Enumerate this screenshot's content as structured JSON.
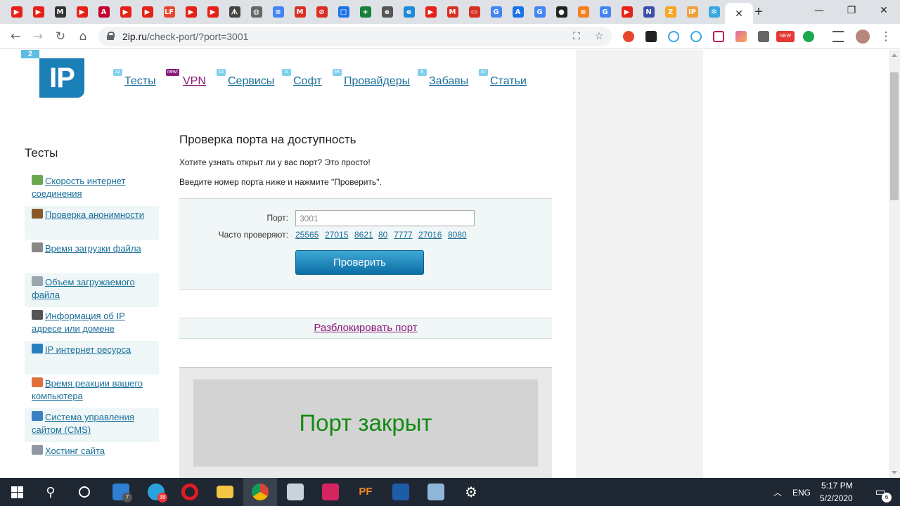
{
  "browser": {
    "url_host": "2ip.ru",
    "url_path": "/check-port/?port=3001",
    "tabs": [
      {
        "icon": "youtube-icon",
        "color": "#e62117",
        "glyph": "▶"
      },
      {
        "icon": "youtube-icon",
        "color": "#e62117",
        "glyph": "▶"
      },
      {
        "icon": "medium-icon",
        "color": "#333333",
        "glyph": "M"
      },
      {
        "icon": "youtube-icon",
        "color": "#e62117",
        "glyph": "▶"
      },
      {
        "icon": "angular-icon",
        "color": "#c3002f",
        "glyph": "A"
      },
      {
        "icon": "youtube-icon",
        "color": "#e62117",
        "glyph": "▶"
      },
      {
        "icon": "youtube-icon",
        "color": "#e62117",
        "glyph": "▶"
      },
      {
        "icon": "lf-icon",
        "color": "#e8452c",
        "glyph": "LF"
      },
      {
        "icon": "youtube-icon",
        "color": "#e62117",
        "glyph": "▶"
      },
      {
        "icon": "youtube-icon",
        "color": "#e62117",
        "glyph": "▶"
      },
      {
        "icon": "site-icon",
        "color": "#444444",
        "glyph": "ᗑ"
      },
      {
        "icon": "globe-icon",
        "color": "#666666",
        "glyph": "◍"
      },
      {
        "icon": "docs-icon",
        "color": "#4285f4",
        "glyph": "≡"
      },
      {
        "icon": "gmail-icon",
        "color": "#d93025",
        "glyph": "M"
      },
      {
        "icon": "no-icon",
        "color": "#d93025",
        "glyph": "⊘"
      },
      {
        "icon": "window-icon",
        "color": "#1a73e8",
        "glyph": "□"
      },
      {
        "icon": "plus-icon",
        "color": "#188038",
        "glyph": "+"
      },
      {
        "icon": "edge-icon",
        "color": "#555555",
        "glyph": "e"
      },
      {
        "icon": "edge-icon",
        "color": "#1f8ad6",
        "glyph": "e"
      },
      {
        "icon": "youtube-icon",
        "color": "#e62117",
        "glyph": "▶"
      },
      {
        "icon": "gmail-icon",
        "color": "#d93025",
        "glyph": "M"
      },
      {
        "icon": "toggle-icon",
        "color": "#d93025",
        "glyph": "▭"
      },
      {
        "icon": "google-icon",
        "color": "#4285f4",
        "glyph": "G"
      },
      {
        "icon": "ads-icon",
        "color": "#1a73e8",
        "glyph": "A"
      },
      {
        "icon": "google-icon",
        "color": "#4285f4",
        "glyph": "G"
      },
      {
        "icon": "github-icon",
        "color": "#222222",
        "glyph": "●"
      },
      {
        "icon": "stack-icon",
        "color": "#f48024",
        "glyph": "≋"
      },
      {
        "icon": "google-icon",
        "color": "#4285f4",
        "glyph": "G"
      },
      {
        "icon": "youtube-icon",
        "color": "#e62117",
        "glyph": "▶"
      },
      {
        "icon": "n-icon",
        "color": "#3c4fa8",
        "glyph": "N"
      },
      {
        "icon": "z-icon",
        "color": "#f5a623",
        "glyph": "Z"
      },
      {
        "icon": "2ip-icon",
        "color": "#f2a03d",
        "glyph": "IP"
      },
      {
        "icon": "gear-icon",
        "color": "#3aa7e0",
        "glyph": "✻"
      }
    ],
    "active_tab_close": "✕",
    "new_tab": "+",
    "window_controls": {
      "minimize": "—",
      "restore": "❐",
      "close": "✕"
    }
  },
  "site": {
    "logo_small": "2",
    "logo": "IP",
    "menu": [
      {
        "badge": "32",
        "label": "Тесты"
      },
      {
        "badge": "new!",
        "label": "VPN"
      },
      {
        "badge": "15",
        "label": "Сервисы"
      },
      {
        "badge": "5",
        "label": "Софт"
      },
      {
        "badge": "4K",
        "label": "Провайдеры"
      },
      {
        "badge": "8",
        "label": "Забавы"
      },
      {
        "badge": "37",
        "label": "Статьи"
      }
    ],
    "sidebar": {
      "title": "Тесты",
      "items": [
        {
          "line1": "Скорость интернет",
          "line2": "соединения",
          "icon": "speed-arrow-icon",
          "color": "#6aa84f"
        },
        {
          "line1": "Проверка анонимности",
          "line2": "",
          "icon": "spy-icon",
          "color": "#8b5a2b"
        },
        {
          "line1": "Время загрузки файла",
          "line2": "",
          "icon": "clock-icon",
          "color": "#888888"
        },
        {
          "line1": "Объем загружаемого",
          "line2": "файла",
          "icon": "file-size-icon",
          "color": "#9aa7b0"
        },
        {
          "line1": "Информация об IP",
          "line2": "адресе или домене",
          "icon": "ip-info-icon",
          "color": "#555555"
        },
        {
          "line1": "IP интернет ресурса",
          "line2": "",
          "icon": "ip-resource-icon",
          "color": "#2a7fc1"
        },
        {
          "line1": "Время реакции вашего",
          "line2": "компьютера",
          "icon": "reaction-icon",
          "color": "#e0703a"
        },
        {
          "line1": "Система управления",
          "line2": "сайтом (CMS)",
          "icon": "cms-icon",
          "color": "#3b7fc4"
        },
        {
          "line1": "Хостинг сайта",
          "line2": "",
          "icon": "hosting-icon",
          "color": "#8d9aa5"
        }
      ]
    },
    "main": {
      "title": "Проверка порта на доступность",
      "intro1": "Хотите узнать открыт ли у вас порт? Это просто!",
      "intro2": "Введите номер порта ниже и нажмите \"Проверить\".",
      "port_label": "Порт:",
      "port_value": "3001",
      "frequent_label": "Часто проверяют:",
      "frequent_ports": [
        "25565",
        "27015",
        "8621",
        "80",
        "7777",
        "27016",
        "8080"
      ],
      "check_button": "Проверить",
      "unblock_link": "Разблокировать порт",
      "result": "Порт закрыт"
    }
  },
  "taskbar": {
    "lang": "ENG",
    "time": "5:17 PM",
    "date": "5/2/2020",
    "mail_badge": "7",
    "telegram_badge": "38",
    "notifications_badge": "6"
  },
  "colors": {
    "link": "#1a6f99",
    "visited": "#8a1c7a",
    "result_green": "#138a13",
    "button_blue": "#0b6ea5"
  }
}
